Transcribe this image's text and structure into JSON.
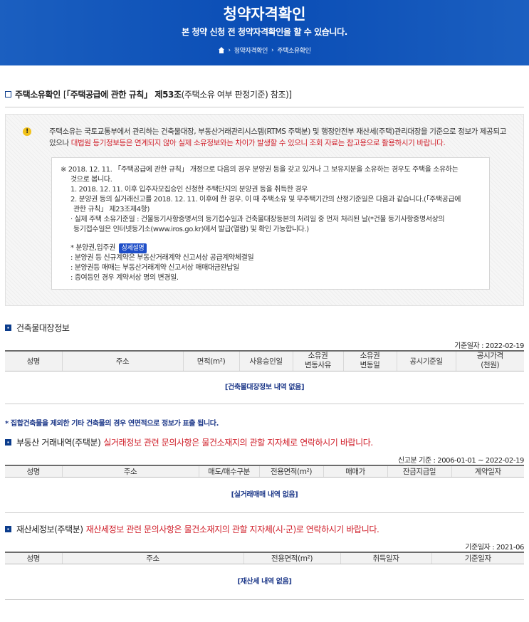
{
  "hero": {
    "title": "청약자격확인",
    "subtitle": "본 청약 신청 전 청약자격확인을 할 수 있습니다.",
    "crumbs": [
      "청약자격확인",
      "주택소유확인"
    ]
  },
  "ownership": {
    "title": "주택소유확인",
    "ref_prefix": "[",
    "ref_bold": "「주택공급에 관한 규칙」 제53조",
    "ref_rest": "(주택소유 여부 판정기준) 참조)]",
    "notice_icon": "!",
    "notice_text_1": "주택소유는 국토교통부에서 관리하는 건축물대장, 부동산거래관리시스템(RTMS 주택분) 및 행정안전부 재산세(주택)관리대장을 기준으로 정보가 제공되고 있으나 ",
    "notice_text_red": "대법원 등기정보등은 연계되지 않아 실제 소유정보와는 차이가 발생할 수 있으니 조회 자료는 참고용으로 활용하시기 바랍니다.",
    "note_lines": [
      "※ 2018. 12. 11. 「주택공급에 관한 규칙」 개정으로 다음의 경우 분양권 등을 갖고 있거나 그 보유지분을 소유하는 경우도 주택을 소유하는",
      "것으로 봅니다.",
      "1. 2018. 12. 11. 이후 입주자모집승인 신청한 주택단지의 분양권 등을 취득한 경우",
      "2. 분양권 등의 실거래신고를 2018. 12. 11. 이후에 한 경우. 이 때 주택소유 및 무주택기간의 산정기준일은 다음과 같습니다.(「주택공급에",
      "관한 규칙」 제23조제4항)",
      "· 실제 주택 소유기준일 : 건물등기사항증명서의 등기접수일과 건축물대장등본의 처리일 중 먼저 처리된 날(*건물 등기사항증명서상의",
      "등기접수일은 인터넷등기소(www.iros.go.kr)에서 발급(열람) 및 확인 가능합니다.)"
    ],
    "presale_label": "* 분양권,입주권",
    "detail_badge": "상세설명",
    "presale_lines": [
      ": 분양권 등 신규계약은 부동산거래계약 신고서상 공급계약체결일",
      ": 분양권등 매매는 부동산거래계약 신고서상 매매대금완납일",
      ": 증여등인 경우 계약서상 명의 변경일."
    ]
  },
  "building": {
    "title": "건축물대장정보",
    "base_date": "기준일자 : 2022-02-19",
    "columns": [
      "성명",
      "주소",
      "면적(m²)",
      "사용승인일",
      "소유권\n변동사유",
      "소유권\n변동일",
      "공시기준일",
      "공시가격\n(천원)"
    ],
    "empty": "[건축물대장정보 내역 없음]",
    "footnote": "* 집합건축물을 제외한 기타 건축물의 경우 연면적으로 정보가 표출 됩니다."
  },
  "realestate": {
    "title": "부동산 거래내역(주택분)",
    "notice": "실거래정보 관련 문의사항은 물건소재지의 관할 지자체로 연락하시기 바랍니다.",
    "base_date": "신고분 기준 : 2006-01-01 ~ 2022-02-19",
    "columns": [
      "성명",
      "주소",
      "매도/매수구분",
      "전용면적(m²)",
      "매매가",
      "잔금지급일",
      "계약일자"
    ],
    "empty": "[실거래매매 내역 없음]"
  },
  "propertytax": {
    "title": "재산세정보(주택분)",
    "notice": "재산세정보 관련 문의사항은 물건소재지의 관할 지자체(시·군)로 연락하시기 바랍니다.",
    "base_date": "기준일자 : 2021-06",
    "columns": [
      "성명",
      "주소",
      "전용면적(m²)",
      "취득일자",
      "기준일자"
    ],
    "empty": "[재산세 내역 없음]"
  }
}
